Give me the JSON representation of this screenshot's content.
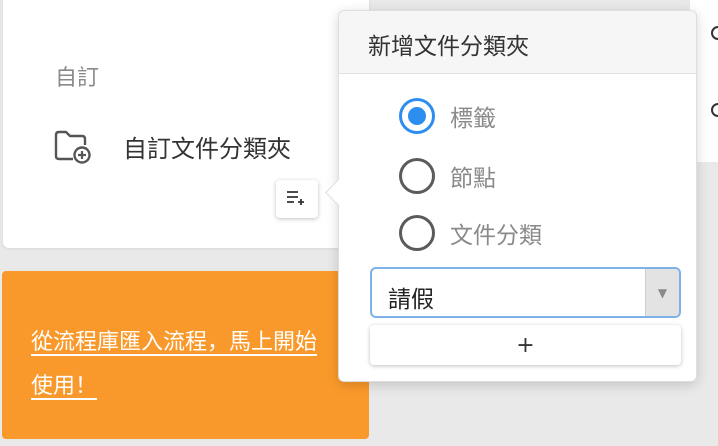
{
  "card": {
    "section_label": "自訂",
    "folder_label": "自訂文件分類夾",
    "folder_icon": "folder-add-icon"
  },
  "promo": {
    "link_text": "從流程庫匯入流程，馬上開始使用！"
  },
  "toolbar": {
    "add_list_icon": "playlist-add-icon"
  },
  "popover": {
    "title": "新增文件分類夾",
    "options": [
      {
        "label": "標籤",
        "checked": true
      },
      {
        "label": "節點",
        "checked": false
      },
      {
        "label": "文件分類",
        "checked": false
      }
    ],
    "select": {
      "value": "請假",
      "arrow": "▼"
    },
    "add_label": "+"
  },
  "colors": {
    "accent": "#2d8ef0",
    "orange": "#fa992b",
    "background": "#e9e9e9"
  }
}
